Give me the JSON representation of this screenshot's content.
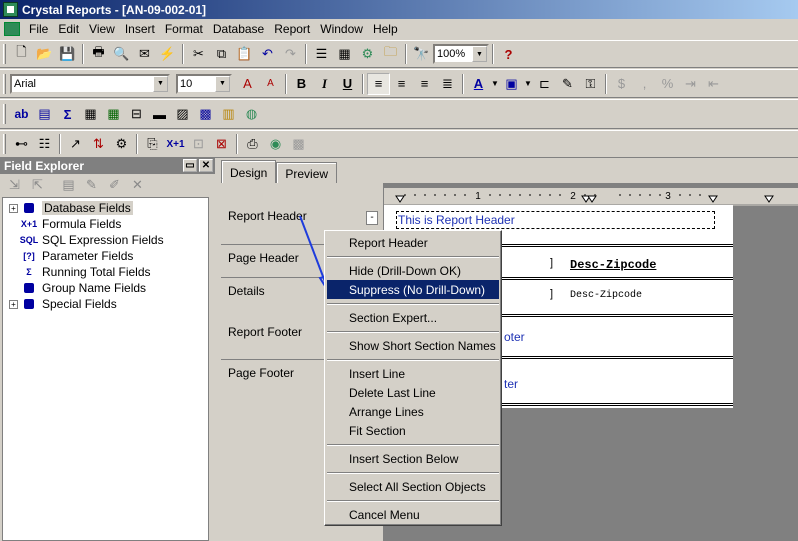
{
  "window": {
    "title": "Crystal Reports - [AN-09-002-01]"
  },
  "menu": [
    "File",
    "Edit",
    "View",
    "Insert",
    "Format",
    "Database",
    "Report",
    "Window",
    "Help"
  ],
  "toolbar_standard": {
    "zoom_value": "100%",
    "icons": [
      "new-icon",
      "open-icon",
      "save-icon",
      "print-icon",
      "print-preview-icon",
      "export-icon",
      "refresh-icon",
      "cut-icon",
      "copy-icon",
      "paste-icon",
      "undo-icon",
      "redo-icon",
      "group-tree-icon",
      "field-explorer-icon",
      "report-explorer-icon",
      "repository-icon",
      "search-icon",
      "help-icon"
    ]
  },
  "toolbar_format": {
    "font_value": "Arial",
    "size_value": "10",
    "bold": "B",
    "italic": "I",
    "underline": "U",
    "currency": "$",
    "comma": ",",
    "percent": "%"
  },
  "field_explorer": {
    "title": "Field Explorer",
    "items": [
      {
        "label": "Database Fields",
        "expandable": true,
        "icon": "database-icon",
        "icon_text": ""
      },
      {
        "label": "Formula Fields",
        "expandable": false,
        "icon": "formula-icon",
        "icon_text": "X+1"
      },
      {
        "label": "SQL Expression Fields",
        "expandable": false,
        "icon": "sql-icon",
        "icon_text": "SQL"
      },
      {
        "label": "Parameter Fields",
        "expandable": false,
        "icon": "parameter-icon",
        "icon_text": "[?]"
      },
      {
        "label": "Running Total Fields",
        "expandable": false,
        "icon": "sigma-icon",
        "icon_text": "Σ"
      },
      {
        "label": "Group Name Fields",
        "expandable": false,
        "icon": "group-icon",
        "icon_text": ""
      },
      {
        "label": "Special Fields",
        "expandable": true,
        "icon": "special-icon",
        "icon_text": ""
      }
    ]
  },
  "tabs": [
    "Design",
    "Preview"
  ],
  "sections": [
    "Report Header",
    "Page Header",
    "Details",
    "Report Footer",
    "Page Footer"
  ],
  "ruler_marks": [
    "1",
    "2",
    "3"
  ],
  "canvas": {
    "report_header_text": "This is Report Header",
    "page_header_field": "Desc-Zipcode",
    "details_field": "Desc-Zipcode",
    "report_footer_partial": "oter",
    "page_footer_partial": "ter"
  },
  "section_button": "-",
  "context_menu": {
    "items": [
      {
        "label": "Report Header",
        "highlighted": false
      },
      {
        "sep": true
      },
      {
        "label": "Hide (Drill-Down OK)",
        "highlighted": false
      },
      {
        "label": "Suppress (No Drill-Down)",
        "highlighted": true
      },
      {
        "sep": true
      },
      {
        "label": "Section Expert...",
        "highlighted": false
      },
      {
        "sep": true
      },
      {
        "label": "Show Short Section Names",
        "highlighted": false
      },
      {
        "sep": true
      },
      {
        "label": "Insert Line",
        "highlighted": false
      },
      {
        "label": "Delete Last Line",
        "highlighted": false
      },
      {
        "label": "Arrange Lines",
        "highlighted": false
      },
      {
        "label": "Fit Section",
        "highlighted": false
      },
      {
        "sep": true
      },
      {
        "label": "Insert Section Below",
        "highlighted": false
      },
      {
        "sep": true
      },
      {
        "label": "Select All Section Objects",
        "highlighted": false
      },
      {
        "sep": true
      },
      {
        "label": "Cancel Menu",
        "highlighted": false
      }
    ]
  },
  "colors": {
    "title_start": "#0a246a",
    "title_end": "#a6caf0",
    "highlight": "#0a246a",
    "annotation_arrow": "#1e3cdc",
    "header_text": "#1e32b4"
  }
}
